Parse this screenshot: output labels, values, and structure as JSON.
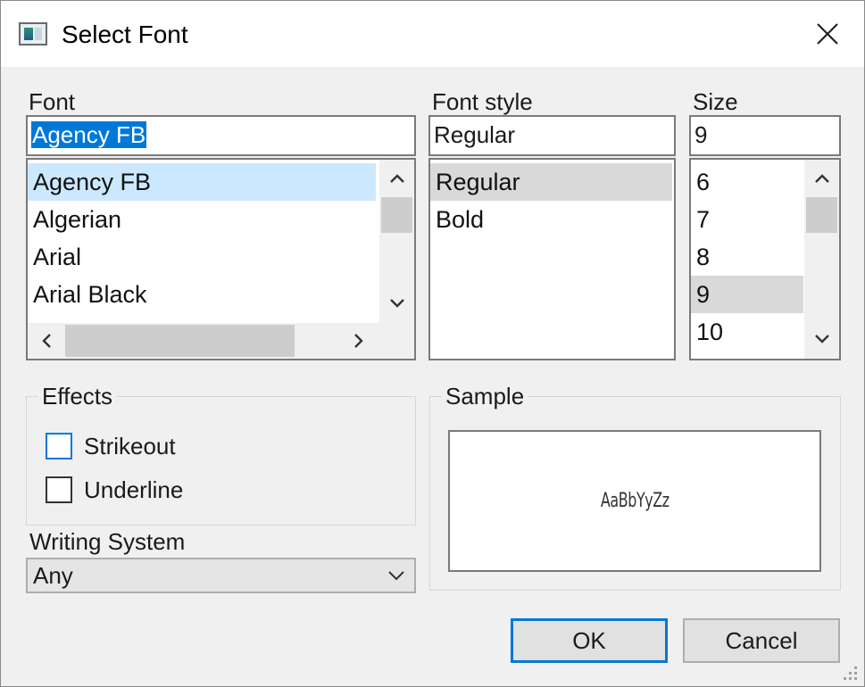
{
  "window": {
    "title": "Select Font",
    "app_icon": "font-dialog-app-icon",
    "close_icon": "close-icon"
  },
  "font": {
    "label": "Font",
    "value": "Agency FB",
    "items": [
      "Agency FB",
      "Algerian",
      "Arial",
      "Arial Black"
    ],
    "selected": "Agency FB"
  },
  "font_style": {
    "label": "Font style",
    "value": "Regular",
    "items": [
      "Regular",
      "Bold"
    ],
    "selected": "Regular"
  },
  "size": {
    "label": "Size",
    "value": "9",
    "items": [
      "6",
      "7",
      "8",
      "9",
      "10"
    ],
    "selected": "9"
  },
  "effects": {
    "title": "Effects",
    "strikeout_label": "Strikeout",
    "underline_label": "Underline",
    "strikeout_checked": false,
    "underline_checked": false
  },
  "writing_system": {
    "label": "Writing System",
    "value": "Any"
  },
  "sample": {
    "title": "Sample",
    "text": "AaBbYyZz"
  },
  "buttons": {
    "ok": "OK",
    "cancel": "Cancel"
  },
  "colors": {
    "accent": "#0078d7",
    "selection_highlight": "#cce8ff",
    "inactive_selection": "#d9d9d9"
  }
}
